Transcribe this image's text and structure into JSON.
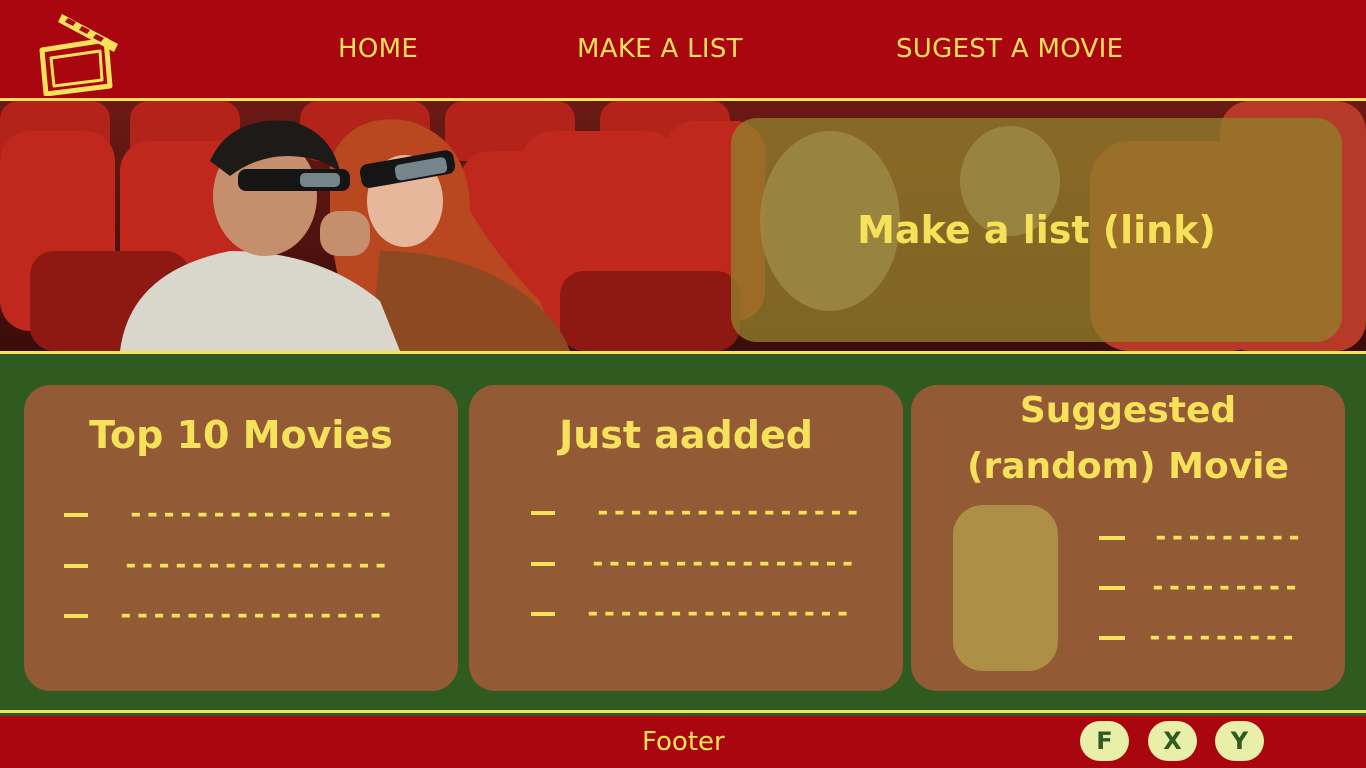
{
  "header": {
    "logo_icon": "clapperboard-icon",
    "nav": [
      {
        "label": "HOME"
      },
      {
        "label": "MAKE A LIST"
      },
      {
        "label": "SUGEST A MOVIE"
      }
    ]
  },
  "hero": {
    "image": "couple-watching-3d-movie-in-cinema",
    "cta_label": "Make a list (link)"
  },
  "cards": [
    {
      "title": "Top 10 Movies",
      "items": [
        "----------------",
        "----------------",
        "----------------"
      ]
    },
    {
      "title": "Just aadded",
      "items": [
        "----------------",
        "----------------",
        "----------------"
      ]
    },
    {
      "title_line1": "Suggested",
      "title_line2": "(random) Movie",
      "items": [
        "---------",
        "---------",
        "---------"
      ]
    }
  ],
  "footer": {
    "label": "Footer",
    "social": [
      {
        "label": "F"
      },
      {
        "label": "X"
      },
      {
        "label": "Y"
      }
    ]
  },
  "colors": {
    "header_red": "#aa0610",
    "accent_yellow": "#f5e15a",
    "panel_green": "#2f5a20",
    "card_brown": "#935a36",
    "overlay_olive": "#927f2c"
  }
}
